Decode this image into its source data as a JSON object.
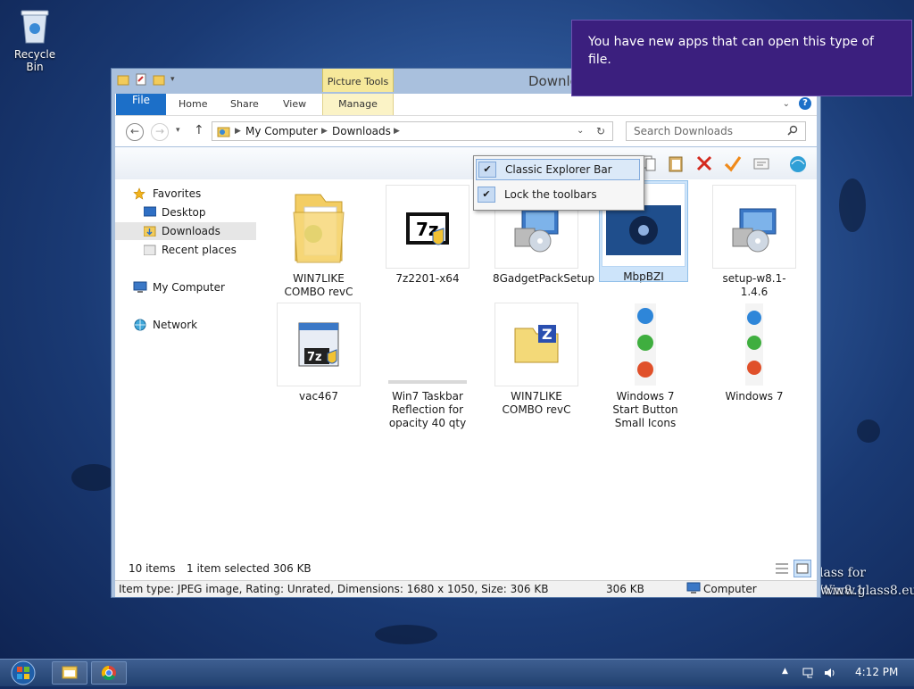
{
  "desktop": {
    "recycle_bin_label": "Recycle Bin",
    "watermark_line1": "lass for Win8.1",
    "watermark_line2": "www.glass8.eu"
  },
  "notification": {
    "text": "You have new apps that can open this type of file."
  },
  "window": {
    "title": "Downlo",
    "context_tab_group": "Picture Tools",
    "ribbon_tabs": [
      "File",
      "Home",
      "Share",
      "View",
      "Manage"
    ],
    "address": {
      "segments": [
        "My Computer",
        "Downloads"
      ]
    },
    "search_placeholder": "Search Downloads",
    "context_menu": {
      "items": [
        {
          "label": "Classic Explorer Bar",
          "checked": true
        },
        {
          "label": "Lock the toolbars",
          "checked": true
        }
      ]
    },
    "nav_pane": {
      "favorites": "Favorites",
      "items": [
        "Desktop",
        "Downloads",
        "Recent places"
      ],
      "computer": "My Computer",
      "network": "Network"
    },
    "files": [
      {
        "name": "WIN7LIKE COMBO revC",
        "icon": "folder-icon"
      },
      {
        "name": "7z2201-x64",
        "icon": "7zip-installer-icon"
      },
      {
        "name": "8GadgetPackSetup",
        "icon": "installer-icon"
      },
      {
        "name": "MbpBZI",
        "icon": "image-thumbnail",
        "selected": true
      },
      {
        "name": "setup-w8.1-1.4.6",
        "icon": "installer-icon"
      },
      {
        "name": "vac467",
        "icon": "7zip-app-icon"
      },
      {
        "name": "Win7 Taskbar Reflection for opacity 40 qty",
        "icon": "strip-image"
      },
      {
        "name": "WIN7LIKE COMBO revC",
        "icon": "zip-folder-icon"
      },
      {
        "name": "Windows 7 Start Button Small Icons",
        "icon": "orb-strip-icon"
      },
      {
        "name": "Windows 7",
        "icon": "orb-strip-icon"
      }
    ],
    "status": {
      "item_count": "10 items",
      "selection": "1 item selected  306 KB",
      "details": "Item type: JPEG image, Rating: Unrated, Dimensions: 1680 x 1050, Size: 306 KB",
      "size": "306 KB",
      "location": "Computer"
    }
  },
  "taskbar": {
    "clock": "4:12 PM"
  },
  "colors": {
    "file_tab": "#1c6fc8",
    "notification_bg": "#3b1f7e",
    "context_tab": "#f6e89a",
    "selection": "#cde4fa"
  }
}
